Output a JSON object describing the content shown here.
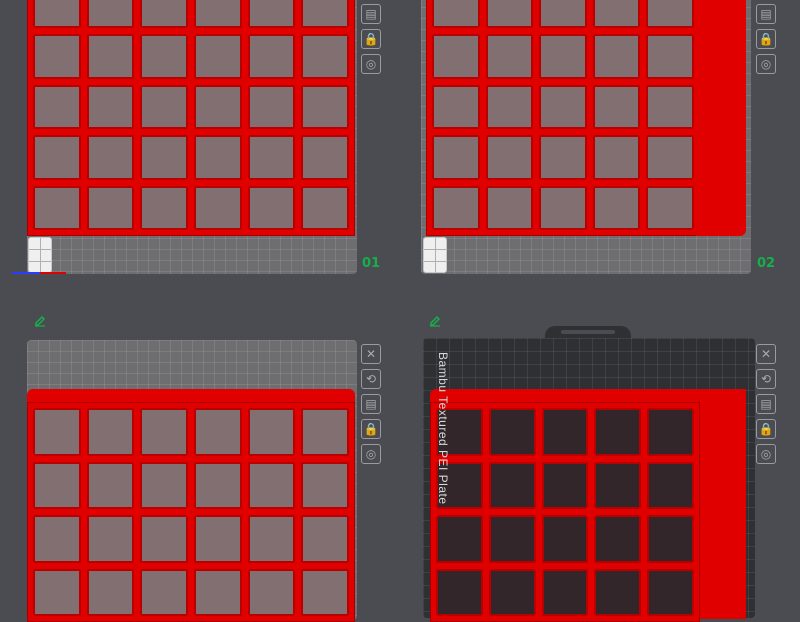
{
  "plates": [
    {
      "number": "01",
      "type": "smooth"
    },
    {
      "number": "02",
      "type": "smooth"
    },
    {
      "number": "",
      "type": "smooth"
    },
    {
      "number": "",
      "type": "textured",
      "label": "Bambu Textured PEI Plate"
    }
  ],
  "toolbar_icons": [
    "close-icon",
    "orient-icon",
    "arrange-icon",
    "lock-icon",
    "settings-icon"
  ],
  "colors": {
    "background": "#4b4c52",
    "plate": "#6e6e70",
    "textured_plate": "#2f3034",
    "model_red": "#e00000",
    "plate_number_green": "#16b04a"
  }
}
